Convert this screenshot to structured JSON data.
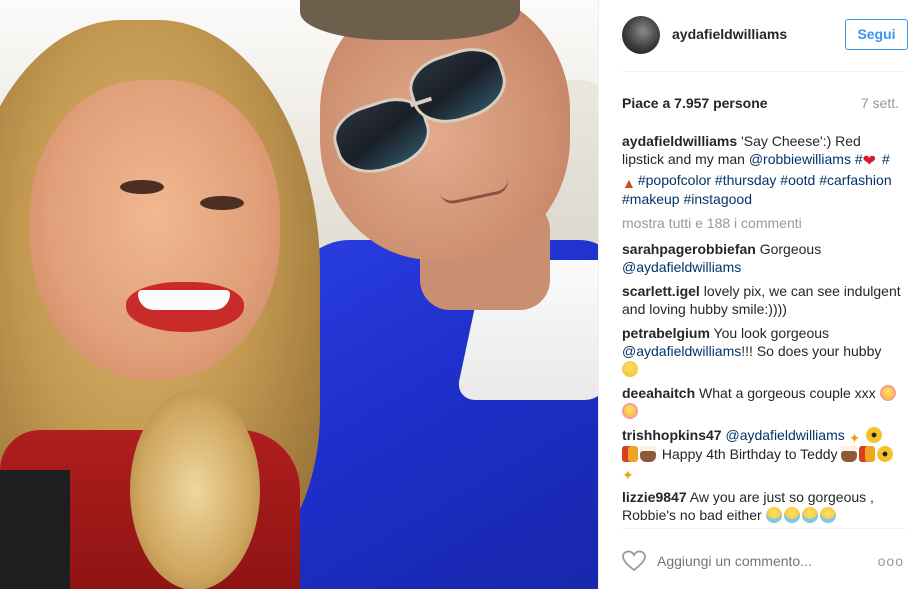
{
  "header": {
    "username": "aydafieldwilliams",
    "follow_label": "Segui"
  },
  "stats": {
    "likes_text": "Piace a 7.957 persone",
    "time_ago": "7 sett."
  },
  "caption": {
    "username": "aydafieldwilliams",
    "text_part1": "'Say Cheese':) Red lipstick and my man",
    "mention": "@robbiewilliams",
    "hashtag1": "#popofcolor",
    "hashtag2": "#thursday",
    "hashtag3": "#ootd",
    "hashtag4": "#carfashion",
    "hashtag5": "#makeup",
    "hashtag6": "#instagood",
    "hash_prefix1": "#",
    "hash_prefix2": "#"
  },
  "show_all_comments": "mostra tutti e 188 i commenti",
  "comments": [
    {
      "username": "sarahpagerobbiefan",
      "text": "Gorgeous",
      "mention": "@aydafieldwilliams"
    },
    {
      "username": "scarlett.igel",
      "text": "lovely pix, we can see indulgent and loving hubby smile:))))"
    },
    {
      "username": "petrabelgium",
      "text": "You look gorgeous",
      "mention": "@aydafieldwilliams",
      "text_after": "!!! So does your hubby"
    },
    {
      "username": "deeahaitch",
      "text": "What a gorgeous couple xxx"
    },
    {
      "username": "trishhopkins47",
      "mention": "@aydafieldwilliams",
      "text": "Happy 4th Birthday to Teddy"
    },
    {
      "username": "lizzie9847",
      "text": "Aw you are just so gorgeous , Robbie's no bad either"
    }
  ],
  "footer": {
    "add_comment_placeholder": "Aggiungi un commento...",
    "more_label": "ooo"
  },
  "icons": {
    "avatar": "profile-avatar",
    "like": "heart-outline-icon",
    "more": "more-dots-icon"
  },
  "colors": {
    "accent": "#3897f0",
    "link": "#003569",
    "muted": "#999999"
  }
}
